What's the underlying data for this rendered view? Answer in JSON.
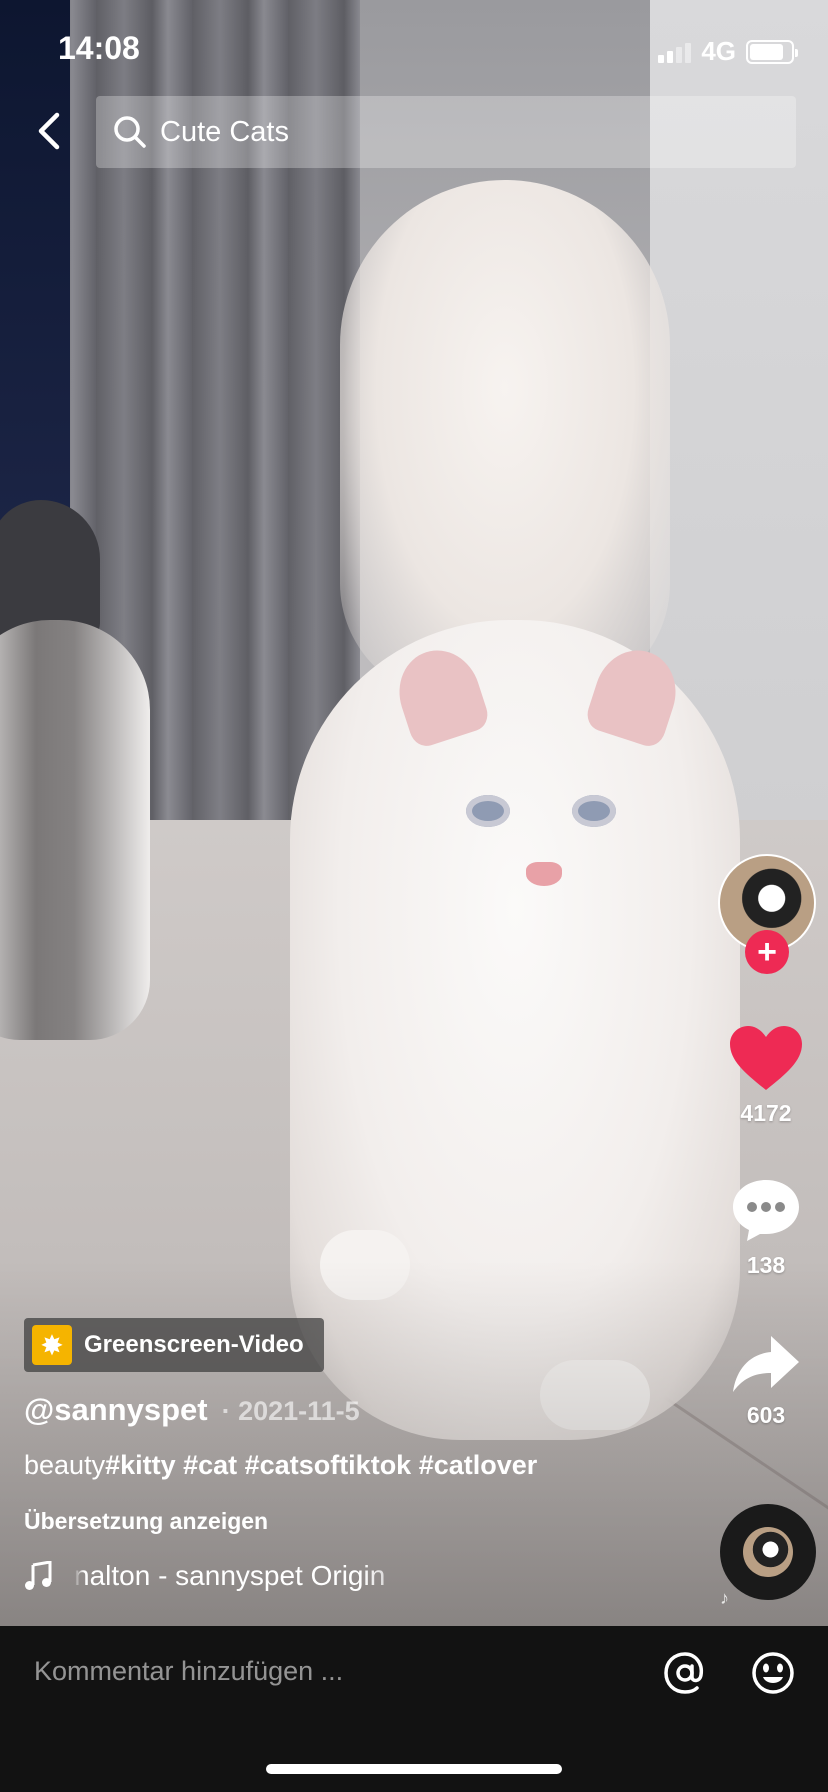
{
  "status_bar": {
    "time": "14:08",
    "network": "4G"
  },
  "search": {
    "query": "Cute Cats"
  },
  "creator": {
    "username": "@sannyspet",
    "date": "· 2021-11-5"
  },
  "effect": {
    "label": "Greenscreen-Video",
    "icon": "sparkle-icon"
  },
  "caption": {
    "prefix": "beauty",
    "tags": "#kitty #cat #catsoftiktok #catlover"
  },
  "translate_label": "Übersetzung anzeigen",
  "sound": {
    "text": "nalton - sannyspet    Origin"
  },
  "actions": {
    "likes": "4172",
    "comments": "138",
    "shares": "603"
  },
  "comment": {
    "placeholder": "Kommentar hinzufügen ..."
  },
  "colors": {
    "like": "#ee2a54",
    "follow": "#ee2a54",
    "effect_icon": "#f5b400"
  }
}
